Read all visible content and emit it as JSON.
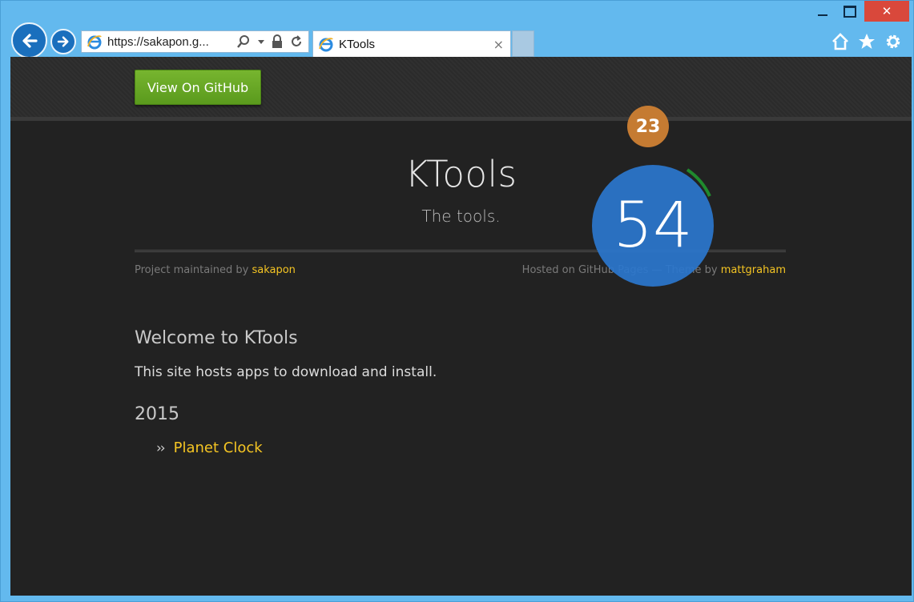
{
  "browser": {
    "url": "https://sakapon.g...",
    "tab_title": "KTools",
    "tab_close": "×",
    "close_glyph": "✕"
  },
  "page": {
    "github_button": "View On GitHub",
    "title": "KTools",
    "subtitle": "The tools.",
    "maintained_prefix": "Project maintained by ",
    "maintainer": "sakapon",
    "hosted_text": "Hosted on GitHub Pages — Theme by ",
    "theme_author": "mattgraham",
    "welcome_heading": "Welcome to KTools",
    "description": "This site hosts apps to download and install.",
    "year_heading": "2015",
    "bullet": "››",
    "items": [
      {
        "label": "Planet Clock"
      }
    ]
  },
  "overlay": {
    "small_badge": "23",
    "big_badge": "54",
    "colors": {
      "small": "#c57b32",
      "big": "#2b76cc",
      "arc": "#1f8a2e"
    }
  },
  "colors": {
    "link": "#f5c523",
    "button_green": "#6aa828",
    "page_bg": "#222222"
  }
}
